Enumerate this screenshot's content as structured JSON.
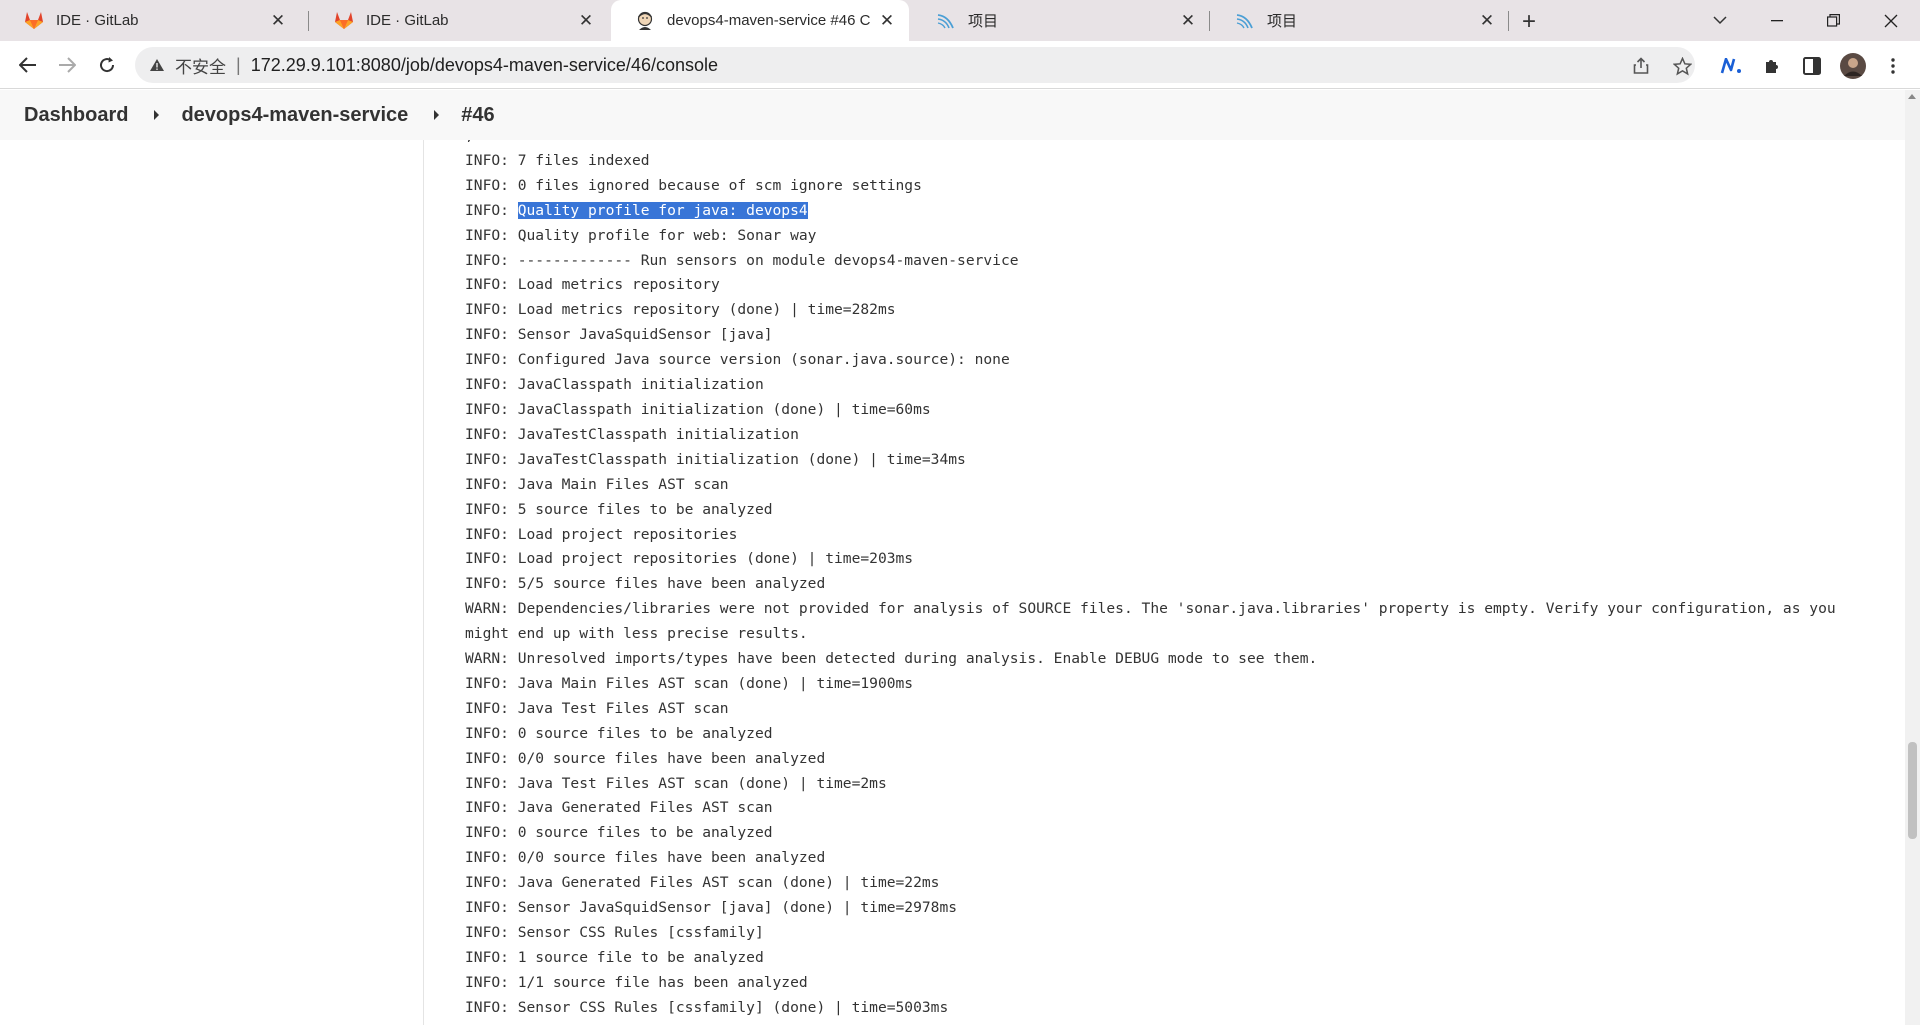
{
  "browser": {
    "tabs": [
      {
        "title": "IDE · GitLab",
        "icon": "gitlab-fox-icon",
        "active": false
      },
      {
        "title": "IDE · GitLab",
        "icon": "gitlab-fox-icon",
        "active": false
      },
      {
        "title": "devops4-maven-service #46 C",
        "icon": "jenkins-butler-icon",
        "active": true
      },
      {
        "title": "项目",
        "icon": "sonarqube-waves-icon",
        "active": false
      },
      {
        "title": "项目",
        "icon": "sonarqube-waves-icon",
        "active": false
      }
    ],
    "address": {
      "security_label": "不安全",
      "separator": "|",
      "url": "172.29.9.101:8080/job/devops4-maven-service/46/console"
    }
  },
  "breadcrumbs": {
    "items": [
      "Dashboard",
      "devops4-maven-service",
      "#46"
    ]
  },
  "console": {
    "lines": [
      {
        "prefix": "",
        "text": ","
      },
      {
        "prefix": "INFO: ",
        "text": "7 files indexed"
      },
      {
        "prefix": "INFO: ",
        "text": "0 files ignored because of scm ignore settings"
      },
      {
        "prefix": "INFO: ",
        "text": "Quality profile for java: devops4",
        "highlight": true
      },
      {
        "prefix": "INFO: ",
        "text": "Quality profile for web: Sonar way"
      },
      {
        "prefix": "INFO: ",
        "text": "------------- Run sensors on module devops4-maven-service"
      },
      {
        "prefix": "INFO: ",
        "text": "Load metrics repository"
      },
      {
        "prefix": "INFO: ",
        "text": "Load metrics repository (done) | time=282ms"
      },
      {
        "prefix": "INFO: ",
        "text": "Sensor JavaSquidSensor [java]"
      },
      {
        "prefix": "INFO: ",
        "text": "Configured Java source version (sonar.java.source): none"
      },
      {
        "prefix": "INFO: ",
        "text": "JavaClasspath initialization"
      },
      {
        "prefix": "INFO: ",
        "text": "JavaClasspath initialization (done) | time=60ms"
      },
      {
        "prefix": "INFO: ",
        "text": "JavaTestClasspath initialization"
      },
      {
        "prefix": "INFO: ",
        "text": "JavaTestClasspath initialization (done) | time=34ms"
      },
      {
        "prefix": "INFO: ",
        "text": "Java Main Files AST scan"
      },
      {
        "prefix": "INFO: ",
        "text": "5 source files to be analyzed"
      },
      {
        "prefix": "INFO: ",
        "text": "Load project repositories"
      },
      {
        "prefix": "INFO: ",
        "text": "Load project repositories (done) | time=203ms"
      },
      {
        "prefix": "INFO: ",
        "text": "5/5 source files have been analyzed"
      },
      {
        "prefix": "WARN: ",
        "text": "Dependencies/libraries were not provided for analysis of SOURCE files. The 'sonar.java.libraries' property is empty. Verify your configuration, as you might end up with less precise results."
      },
      {
        "prefix": "WARN: ",
        "text": "Unresolved imports/types have been detected during analysis. Enable DEBUG mode to see them."
      },
      {
        "prefix": "INFO: ",
        "text": "Java Main Files AST scan (done) | time=1900ms"
      },
      {
        "prefix": "INFO: ",
        "text": "Java Test Files AST scan"
      },
      {
        "prefix": "INFO: ",
        "text": "0 source files to be analyzed"
      },
      {
        "prefix": "INFO: ",
        "text": "0/0 source files have been analyzed"
      },
      {
        "prefix": "INFO: ",
        "text": "Java Test Files AST scan (done) | time=2ms"
      },
      {
        "prefix": "INFO: ",
        "text": "Java Generated Files AST scan"
      },
      {
        "prefix": "INFO: ",
        "text": "0 source files to be analyzed"
      },
      {
        "prefix": "INFO: ",
        "text": "0/0 source files have been analyzed"
      },
      {
        "prefix": "INFO: ",
        "text": "Java Generated Files AST scan (done) | time=22ms"
      },
      {
        "prefix": "INFO: ",
        "text": "Sensor JavaSquidSensor [java] (done) | time=2978ms"
      },
      {
        "prefix": "INFO: ",
        "text": "Sensor CSS Rules [cssfamily]"
      },
      {
        "prefix": "INFO: ",
        "text": "1 source file to be analyzed"
      },
      {
        "prefix": "INFO: ",
        "text": "1/1 source file has been analyzed"
      },
      {
        "prefix": "INFO: ",
        "text": "Sensor CSS Rules [cssfamily] (done) | time=5003ms"
      }
    ]
  },
  "colors": {
    "selection": "#3875d7",
    "tabstrip": "#e8e3e6",
    "breadcrumb_bg": "#f8f8f8"
  }
}
